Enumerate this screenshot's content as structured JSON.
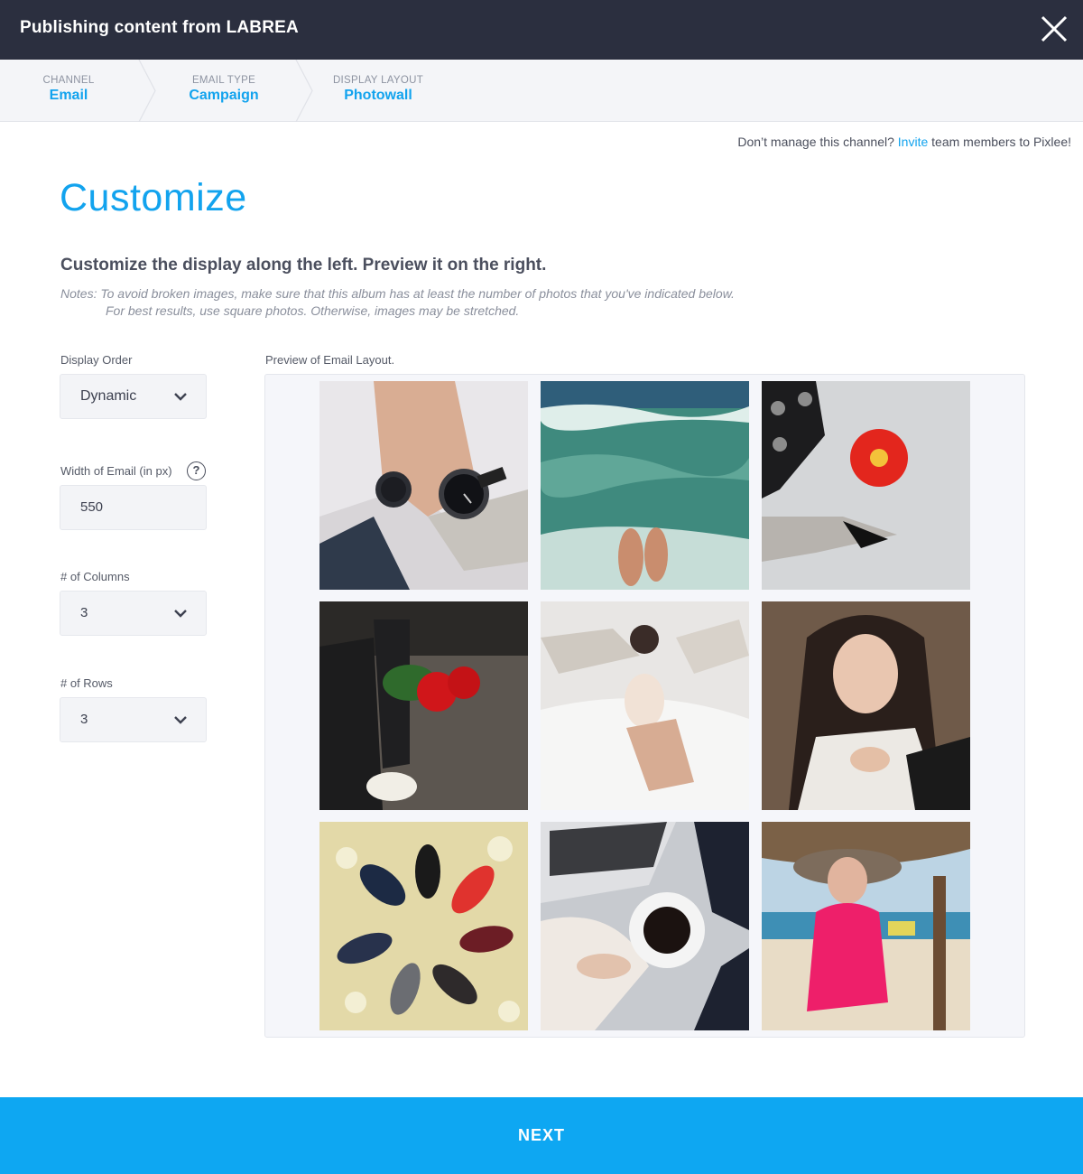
{
  "header": {
    "title": "Publishing content from LABREA"
  },
  "steps": [
    {
      "label": "CHANNEL",
      "value": "Email"
    },
    {
      "label": "EMAIL TYPE",
      "value": "Campaign"
    },
    {
      "label": "DISPLAY LAYOUT",
      "value": "Photowall"
    }
  ],
  "invite": {
    "prefix": "Don’t manage this channel? ",
    "link": "Invite",
    "suffix": " team members to Pixlee!"
  },
  "page": {
    "title": "Customize",
    "subtitle": "Customize the display along the left. Preview it on the right.",
    "notes_line1": "Notes: To avoid broken images, make sure that this album has at least the number of photos that you've indicated below.",
    "notes_line2": "For best results, use square photos. Otherwise, images may be stretched."
  },
  "form": {
    "display_order": {
      "label": "Display Order",
      "value": "Dynamic"
    },
    "width": {
      "label": "Width of Email (in px)",
      "value": "550",
      "help": "?"
    },
    "columns": {
      "label": "# of Columns",
      "value": "3"
    },
    "rows": {
      "label": "# of Rows",
      "value": "3"
    }
  },
  "preview": {
    "label": "Preview of Email Layout.",
    "photos": [
      {
        "name": "watches-photo"
      },
      {
        "name": "ocean-feet-photo"
      },
      {
        "name": "red-flower-shoes-photo"
      },
      {
        "name": "roses-sneakers-photo"
      },
      {
        "name": "hammock-beach-photo"
      },
      {
        "name": "selfie-photo"
      },
      {
        "name": "shoes-circle-photo"
      },
      {
        "name": "coffee-laptop-photo"
      },
      {
        "name": "beach-hat-photo"
      }
    ]
  },
  "footer": {
    "next_label": "NEXT"
  },
  "colors": {
    "accent": "#12a3ee",
    "topbar": "#2b2f3f",
    "next": "#0ea7f2"
  }
}
